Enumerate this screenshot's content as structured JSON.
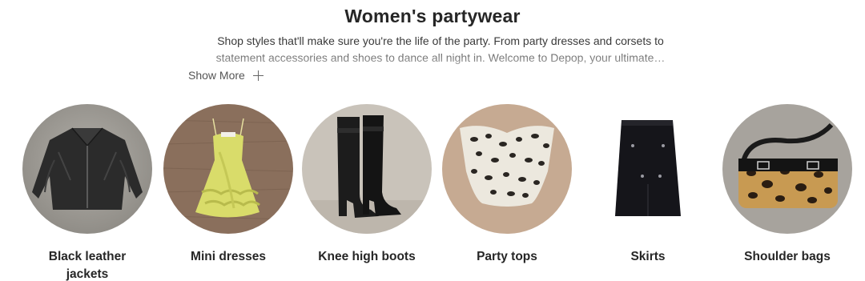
{
  "header": {
    "title": "Women's partywear",
    "description_line1": "Shop styles that'll make sure you're the life of the party. From party dresses and corsets to",
    "description_line2": "statement accessories and shoes to dance all night in. Welcome to Depop, your ultimate…",
    "show_more_label": "Show More"
  },
  "categories": [
    {
      "label": "Black leather jackets",
      "image": "black-leather-jacket",
      "bg_color": "#9a9791"
    },
    {
      "label": "Mini dresses",
      "image": "yellow-mini-dress",
      "bg_color": "#8a6f5c"
    },
    {
      "label": "Knee high boots",
      "image": "black-knee-high-boots",
      "bg_color": "#c9c3ba"
    },
    {
      "label": "Party tops",
      "image": "leopard-corset-top",
      "bg_color": "#c6aa92"
    },
    {
      "label": "Skirts",
      "image": "black-midi-skirt",
      "bg_color": "#f2f2f2"
    },
    {
      "label": "Shoulder bags",
      "image": "leopard-shoulder-bag",
      "bg_color": "#a7a39d"
    }
  ]
}
